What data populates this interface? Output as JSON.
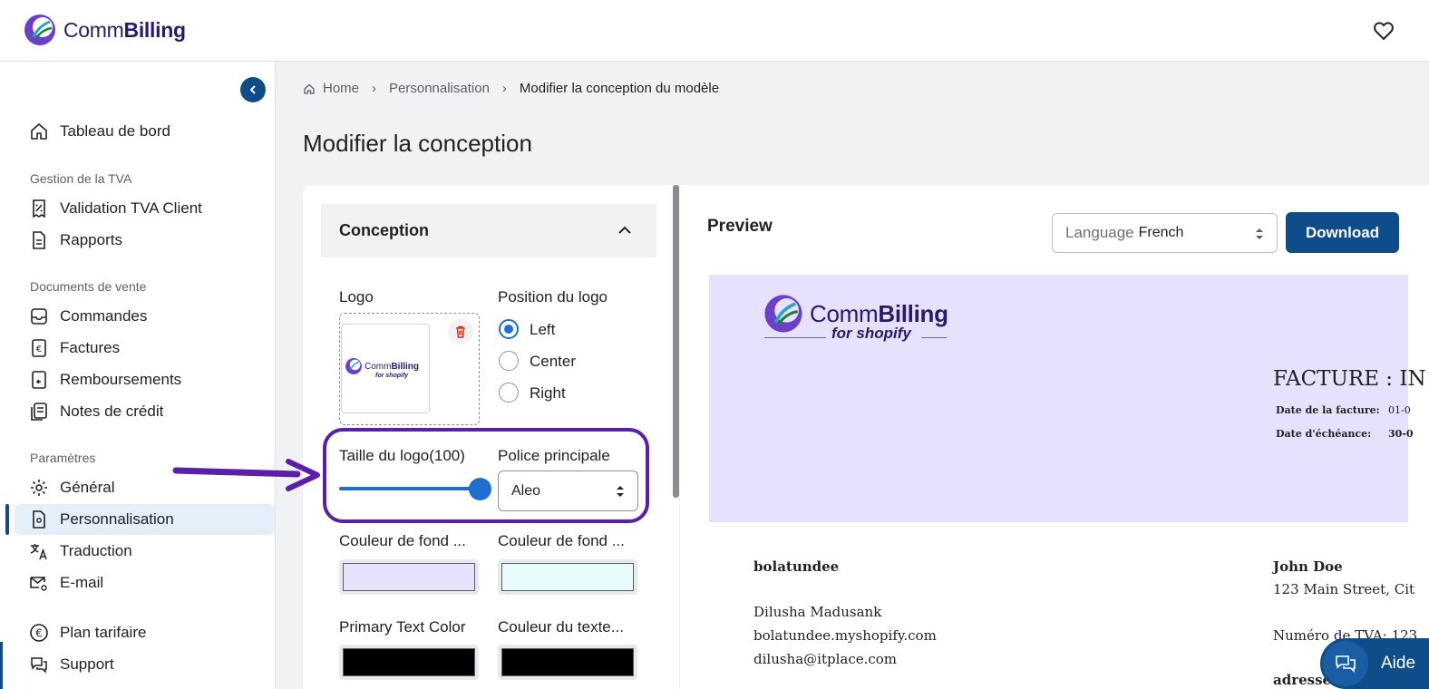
{
  "app": {
    "brand_prefix": "Comm",
    "brand_suffix": "Billing"
  },
  "sidebar": {
    "dashboard": "Tableau de bord",
    "section_vat": "Gestion de la TVA",
    "vat_validation": "Validation TVA Client",
    "reports": "Rapports",
    "section_sales": "Documents de vente",
    "orders": "Commandes",
    "invoices": "Factures",
    "refunds": "Remboursements",
    "credit_notes": "Notes de crédit",
    "section_settings": "Paramètres",
    "general": "Général",
    "customization": "Personnalisation",
    "translation": "Traduction",
    "email": "E-mail",
    "pricing": "Plan tarifaire",
    "support": "Support"
  },
  "breadcrumb": {
    "home": "Home",
    "parent": "Personnalisation",
    "current": "Modifier la conception du modèle"
  },
  "page": {
    "title": "Modifier la conception"
  },
  "editor": {
    "section_title": "Conception",
    "logo_label": "Logo",
    "logo_position_label": "Position du logo",
    "position_left": "Left",
    "position_center": "Center",
    "position_right": "Right",
    "logo_size_label": "Taille du logo(100)",
    "logo_size_value": 100,
    "font_label": "Police principale",
    "font_value": "Aleo",
    "bg_color_1_label": "Couleur de fond ...",
    "bg_color_2_label": "Couleur de fond ...",
    "primary_text_label": "Primary Text Color",
    "secondary_text_label": "Couleur du texte...",
    "thumb_brand_prefix": "Comm",
    "thumb_brand_suffix": "Billing",
    "thumb_sub": "for shopify"
  },
  "colors": {
    "bg1": "#e6e1fd",
    "bg2": "#e8fdfb",
    "primary_text": "#000000",
    "secondary_text": "#000000",
    "accent": "#0f4c8a",
    "highlight": "#5a1fa8"
  },
  "preview": {
    "title": "Preview",
    "language_prefix": "Language",
    "language_value": "French",
    "download": "Download",
    "brand_prefix": "Comm",
    "brand_suffix": "Billing",
    "brand_sub": "for shopify",
    "invoice_title": "FACTURE : IN",
    "invoice_date_label": "Date de la facture:",
    "invoice_date_value": "01-0",
    "due_date_label": "Date d'échéance:",
    "due_date_value": "30-0",
    "seller_name": "bolatundee",
    "seller_contact": "Dilusha Madusank",
    "seller_site": "bolatundee.myshopify.com",
    "seller_email": "dilusha@itplace.com",
    "buyer_name": "John Doe",
    "buyer_address": "123 Main Street, Cit",
    "buyer_vat": "Numéro de TVA: 123",
    "buyer_address_label": "adresse"
  },
  "help": {
    "label": "Aide"
  }
}
